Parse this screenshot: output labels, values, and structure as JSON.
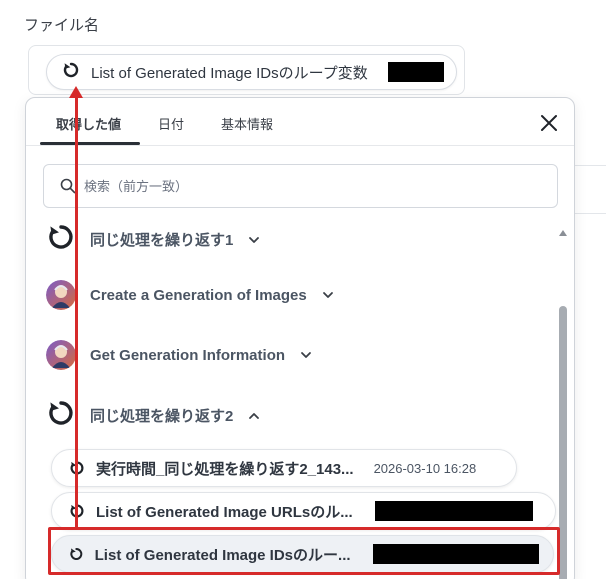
{
  "field": {
    "label": "ファイル名",
    "chip_text": "List of Generated Image IDsのループ変数"
  },
  "panel": {
    "tabs": [
      {
        "label": "取得した値"
      },
      {
        "label": "日付"
      },
      {
        "label": "基本情報"
      }
    ],
    "search_placeholder": "検索（前方一致）",
    "groups": [
      {
        "label": "同じ処理を繰り返す1",
        "icon": "loop-icon",
        "expanded": false
      },
      {
        "label": "Create a Generation of Images",
        "icon": "app-avatar",
        "expanded": false
      },
      {
        "label": "Get Generation Information",
        "icon": "app-avatar",
        "expanded": false
      },
      {
        "label": "同じ処理を繰り返す2",
        "icon": "loop-icon",
        "expanded": true
      }
    ],
    "items": [
      {
        "label": "実行時間_同じ処理を繰り返す2_143...",
        "date": "2026-03-10 16:28"
      },
      {
        "label": "List of Generated Image URLsのル..."
      },
      {
        "label": "List of Generated Image IDsのルー...",
        "selected": true
      }
    ]
  },
  "colors": {
    "annotation_red": "#d62a2a",
    "text_dark": "#2f3640",
    "text_group": "#4b5563"
  }
}
